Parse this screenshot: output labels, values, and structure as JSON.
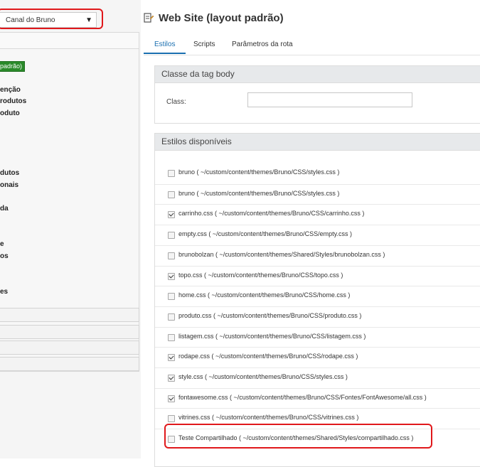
{
  "sidebar": {
    "channel_select_value": "Canal do Bruno",
    "channel_select_arrow": "▼",
    "badge_default": "padrão)",
    "items": [
      "enção",
      "rodutos",
      "oduto",
      "dutos",
      "onais",
      "da",
      "e",
      "os",
      "es"
    ]
  },
  "main": {
    "title": "Web Site (layout padrão)",
    "title_icon": "edit-page-icon",
    "tabs": [
      "Estilos",
      "Scripts",
      "Parâmetros da rota"
    ],
    "active_tab": "Estilos",
    "body_class_panel": {
      "title": "Classe da tag body",
      "field_label": "Class:",
      "field_value": ""
    },
    "styles_panel": {
      "title": "Estilos disponíveis",
      "rows": [
        {
          "label": "bruno ( ~/custom/content/themes/Bruno/CSS/styles.css )",
          "checked": false
        },
        {
          "label": "bruno ( ~/custom/content/themes/Bruno/CSS/styles.css )",
          "checked": false
        },
        {
          "label": "carrinho.css ( ~/custom/content/themes/Bruno/CSS/carrinho.css )",
          "checked": true
        },
        {
          "label": "empty.css ( ~/custom/content/themes/Bruno/CSS/empty.css )",
          "checked": false
        },
        {
          "label": "brunobolzan ( ~/custom/content/themes/Shared/Styles/brunobolzan.css )",
          "checked": false
        },
        {
          "label": "topo.css ( ~/custom/content/themes/Bruno/CSS/topo.css )",
          "checked": true
        },
        {
          "label": "home.css ( ~/custom/content/themes/Bruno/CSS/home.css )",
          "checked": false
        },
        {
          "label": "produto.css ( ~/custom/content/themes/Bruno/CSS/produto.css )",
          "checked": false
        },
        {
          "label": "listagem.css ( ~/custom/content/themes/Bruno/CSS/listagem.css )",
          "checked": false
        },
        {
          "label": "rodape.css ( ~/custom/content/themes/Bruno/CSS/rodape.css )",
          "checked": true
        },
        {
          "label": "style.css ( ~/custom/content/themes/Bruno/CSS/styles.css )",
          "checked": true
        },
        {
          "label": "fontawesome.css ( ~/custom/content/themes/Bruno/CSS/Fontes/FontAwesome/all.css )",
          "checked": true
        },
        {
          "label": "vitrines.css ( ~/custom/content/themes/Bruno/CSS/vitrines.css )",
          "checked": false
        },
        {
          "label": "Teste Compartilhado ( ~/custom/content/themes/Shared/Styles/compartilhado.css )",
          "checked": false
        }
      ]
    }
  },
  "colors": {
    "accent": "#1a6fb0",
    "highlight": "#e0181b",
    "badge": "#2a8a2a",
    "panel_header": "#e7e9eb"
  }
}
